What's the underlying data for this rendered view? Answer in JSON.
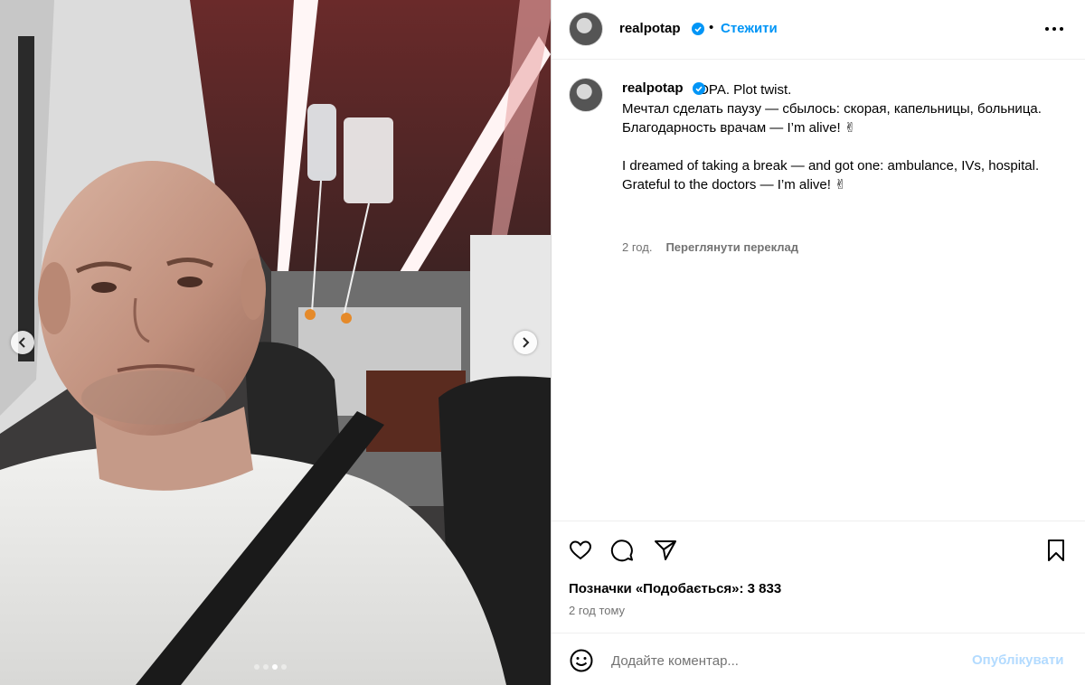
{
  "post": {
    "author": "realpotap",
    "follow_label": "Стежити",
    "separator": "•",
    "caption_lead": "OPA. Plot twist.",
    "caption_body": "Мечтал сделать паузу — сбылось: скорая, капельницы, больница.\nБлагодарность врачам — I’m alive! ✌\n\nI dreamed of taking a break — and got one: ambulance, IVs, hospital.\nGrateful to the doctors — I’m alive! ✌",
    "caption_age": "2 год.",
    "translate_label": "Переглянути переклад",
    "likes_text": "Позначки «Подобається»: 3 833",
    "posted_time": "2 год тому"
  },
  "comment_box": {
    "placeholder": "Додайте коментар...",
    "publish_label": "Опублікувати"
  },
  "carousel": {
    "slide_count": 4,
    "active_index": 2
  },
  "icons": {
    "verified": "verified-badge-icon",
    "more": "more-options-icon",
    "like": "heart-icon",
    "comment": "comment-icon",
    "share": "paper-plane-icon",
    "save": "bookmark-icon",
    "emoji": "emoji-icon",
    "prev": "chevron-left-icon",
    "next": "chevron-right-icon"
  },
  "colors": {
    "accent": "#0095f6",
    "publish_disabled": "#b3dbff",
    "muted": "#737373"
  }
}
